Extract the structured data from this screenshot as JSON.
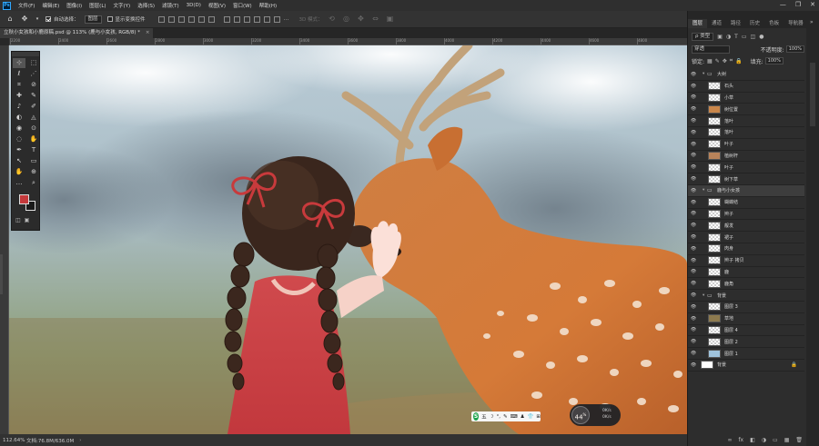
{
  "app": {
    "logo": "Ps",
    "menu": [
      "文件(F)",
      "编辑(E)",
      "图像(I)",
      "图层(L)",
      "文字(Y)",
      "选择(S)",
      "滤镜(T)",
      "3D(D)",
      "视图(V)",
      "窗口(W)",
      "帮助(H)"
    ],
    "window_controls": [
      "—",
      "❐",
      "✕"
    ]
  },
  "options_bar": {
    "auto_select_label": "自动选择：",
    "auto_select_checked": true,
    "auto_select_target": "图层",
    "show_transform_label": "显示变换控件",
    "show_transform_checked": false,
    "mode_3d_label": "3D 模式："
  },
  "document": {
    "tab_title": "立秋小女孩和小鹿原稿.psd @ 113% (鹿与小女孩, RGB/8) *",
    "tab_close": "×",
    "ruler_ticks": [
      "2200",
      "2400",
      "2600",
      "2800",
      "3000",
      "3200",
      "3400",
      "3600",
      "3800",
      "4000",
      "4200",
      "4400",
      "4600",
      "4800"
    ]
  },
  "toolbar": {
    "tools": [
      "⊹",
      "⬚",
      "ℓ",
      "⋰",
      "⌗",
      "⊘",
      "✚",
      "✎",
      "♪",
      "✐",
      "◐",
      "◬",
      "◉",
      "⊙",
      "◌",
      "✋",
      "✒",
      "T",
      "↖",
      "▭",
      "✋",
      "⊕",
      "…",
      "⌕"
    ],
    "foreground_color": "#c4393b",
    "background_color": "#1a1a1a",
    "extra_icons": [
      "◫",
      "▣"
    ]
  },
  "status_bar": {
    "zoom": "112.64%",
    "doc_info": "文档:76.8M/636.0M",
    "arrow": "›"
  },
  "ime": {
    "logo": "S",
    "items": [
      "五",
      "☽",
      "°,",
      "✎",
      "⌨",
      "♟",
      "👕",
      "⊞"
    ]
  },
  "speed_widget": {
    "percent": "44",
    "percent_unit": "%",
    "up": "0K/s",
    "down": "0K/s"
  },
  "layers_panel": {
    "tabs": [
      "图层",
      "通道",
      "路径",
      "历史",
      "色板",
      "导航器"
    ],
    "active_tab": 0,
    "filter_type": "ρ 类型",
    "blend_mode": "穿透",
    "opacity_label": "不透明度:",
    "opacity_value": "100%",
    "lock_label": "锁定:",
    "fill_label": "填充:",
    "fill_value": "100%",
    "layers": [
      {
        "name": "大树",
        "type": "group",
        "indent": 0
      },
      {
        "name": "石头",
        "type": "layer",
        "indent": 1
      },
      {
        "name": "小草",
        "type": "layer",
        "indent": 1
      },
      {
        "name": "树位置",
        "type": "layer",
        "indent": 1,
        "thumb": "#c9864a"
      },
      {
        "name": "落叶",
        "type": "layer",
        "indent": 1
      },
      {
        "name": "落叶",
        "type": "layer",
        "indent": 1
      },
      {
        "name": "叶子",
        "type": "layer",
        "indent": 1
      },
      {
        "name": "植树杆",
        "type": "layer",
        "indent": 1,
        "thumb": "#b8835a"
      },
      {
        "name": "叶子",
        "type": "layer",
        "indent": 1
      },
      {
        "name": "树下草",
        "type": "layer",
        "indent": 1
      },
      {
        "name": "鹿与小女孩",
        "type": "group",
        "indent": 0,
        "selected": true
      },
      {
        "name": "蝴蝶结",
        "type": "layer",
        "indent": 1
      },
      {
        "name": "辫子",
        "type": "layer",
        "indent": 1
      },
      {
        "name": "靓发",
        "type": "layer",
        "indent": 1
      },
      {
        "name": "裙子",
        "type": "layer",
        "indent": 1
      },
      {
        "name": "肉身",
        "type": "layer",
        "indent": 1
      },
      {
        "name": "辫子 拷贝",
        "type": "layer",
        "indent": 1
      },
      {
        "name": "鹿",
        "type": "layer",
        "indent": 1
      },
      {
        "name": "鹿角",
        "type": "layer",
        "indent": 1
      },
      {
        "name": "背景",
        "type": "group",
        "indent": 0
      },
      {
        "name": "图层 3",
        "type": "layer",
        "indent": 1
      },
      {
        "name": "草地",
        "type": "layer",
        "indent": 1,
        "thumb": "#8d7a4e"
      },
      {
        "name": "图层 4",
        "type": "layer",
        "indent": 1
      },
      {
        "name": "图层 2",
        "type": "layer",
        "indent": 1
      },
      {
        "name": "图层 1",
        "type": "layer",
        "indent": 1,
        "thumb": "#9fc3dc"
      },
      {
        "name": "背景",
        "type": "background",
        "indent": 0,
        "thumb": "#ffffff",
        "locked": true
      }
    ],
    "footer_icons": [
      "fx",
      "◧",
      "◑",
      "▭",
      "▦",
      "🗑"
    ]
  }
}
